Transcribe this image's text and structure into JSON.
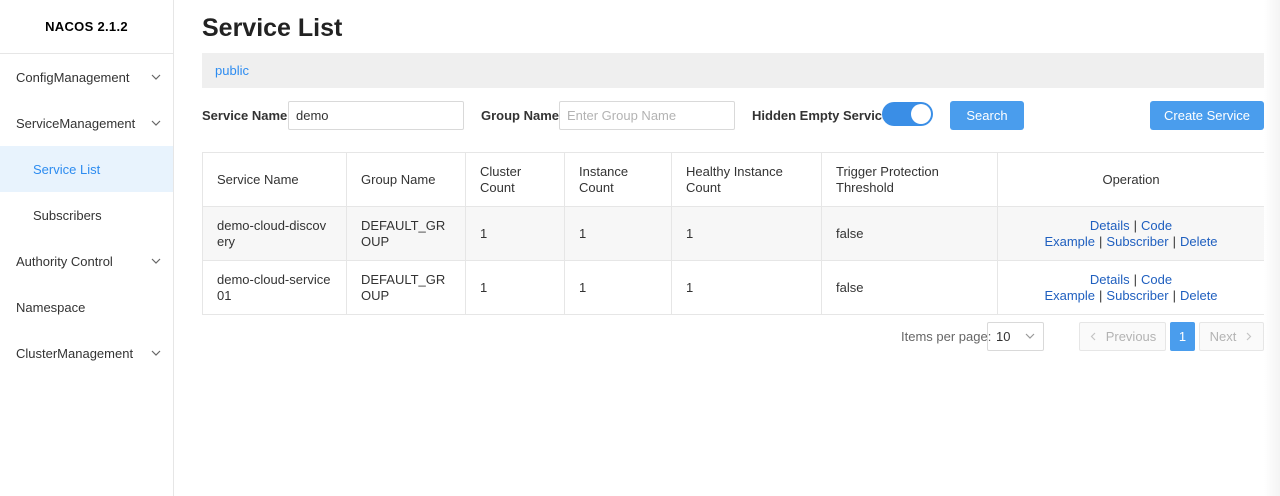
{
  "app": {
    "title": "NACOS 2.1.2"
  },
  "sidebar": {
    "items": [
      {
        "label": "ConfigManagement",
        "expandable": true
      },
      {
        "label": "ServiceManagement",
        "expandable": true
      },
      {
        "label": "Service List",
        "active": true,
        "sub": true
      },
      {
        "label": "Subscribers",
        "sub": true
      },
      {
        "label": "Authority Control",
        "expandable": true
      },
      {
        "label": "Namespace"
      },
      {
        "label": "ClusterManagement",
        "expandable": true
      }
    ]
  },
  "page": {
    "title": "Service List"
  },
  "namespace": {
    "current": "public"
  },
  "filter": {
    "service_name_label": "Service Name",
    "service_name_value": "demo",
    "group_name_label": "Group Name",
    "group_name_placeholder": "Enter Group Name",
    "hidden_empty_label": "Hidden Empty Service",
    "hidden_empty_on": true,
    "search_label": "Search",
    "create_label": "Create Service"
  },
  "table": {
    "headers": [
      "Service Name",
      "Group Name",
      "Cluster Count",
      "Instance Count",
      "Healthy Instance Count",
      "Trigger Protection Threshold",
      "Operation"
    ],
    "rows": [
      {
        "service": "demo-cloud-discovery",
        "group": "DEFAULT_GROUP",
        "cluster": "1",
        "instance": "1",
        "healthy": "1",
        "threshold": "false"
      },
      {
        "service": "demo-cloud-service01",
        "group": "DEFAULT_GROUP",
        "cluster": "1",
        "instance": "1",
        "healthy": "1",
        "threshold": "false"
      }
    ],
    "ops": {
      "details": "Details",
      "code": "Code",
      "example": "Example",
      "subscriber": "Subscriber",
      "delete": "Delete",
      "sep": "|"
    }
  },
  "pagination": {
    "items_per_page_label": "Items per page:",
    "page_size": "10",
    "previous": "Previous",
    "next": "Next",
    "current_page": "1"
  },
  "colors": {
    "accent": "#4a9ded",
    "link": "#1f5fbf",
    "active_bg": "#e8f3fd"
  }
}
